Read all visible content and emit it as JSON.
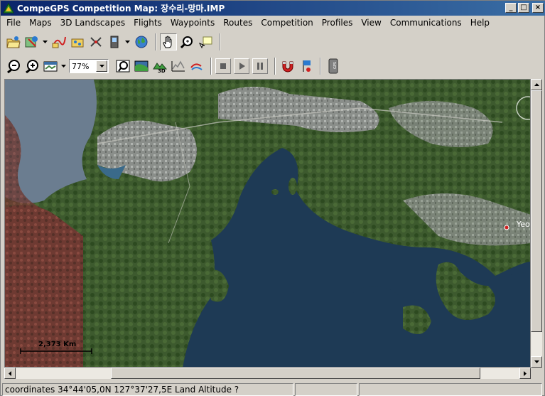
{
  "window": {
    "title": "CompeGPS Competition Map: 장수리-망마.IMP",
    "minimize_label": "_",
    "maximize_label": "□",
    "close_label": "×"
  },
  "menu": [
    "File",
    "Maps",
    "3D Landscapes",
    "Flights",
    "Waypoints",
    "Routes",
    "Competition",
    "Profiles",
    "View",
    "Communications",
    "Help"
  ],
  "toolbar1": {
    "icons": [
      "open-folder-icon",
      "map-open-icon",
      "track-icon",
      "waypoints-icon",
      "route-icon",
      "device-icon",
      "globe-icon",
      "hand-pan-icon",
      "zoom-tool-icon",
      "note-icon"
    ]
  },
  "toolbar2": {
    "zoom_value": "77%",
    "icons": [
      "zoom-out-icon",
      "zoom-in-icon",
      "map-view-icon",
      "zoom-fit-icon",
      "layers-icon",
      "3d-icon",
      "profile-graph-icon",
      "track-arrow-icon",
      "stop-icon",
      "play-icon",
      "pause-icon",
      "magnet-icon",
      "flag-icon",
      "gps-icon"
    ]
  },
  "map": {
    "scale_label": "2,373 Km",
    "place_label": "Yeos"
  },
  "status": {
    "coordinates": "coordinates 34°44'05,0N 127°37'27,5E Land Altitude ?",
    "pane2": "",
    "pane3": ""
  },
  "colors": {
    "title_start": "#0a246a",
    "title_end": "#3a6ea5",
    "sea": "#1e3a55",
    "land": "#3d5a2e"
  }
}
